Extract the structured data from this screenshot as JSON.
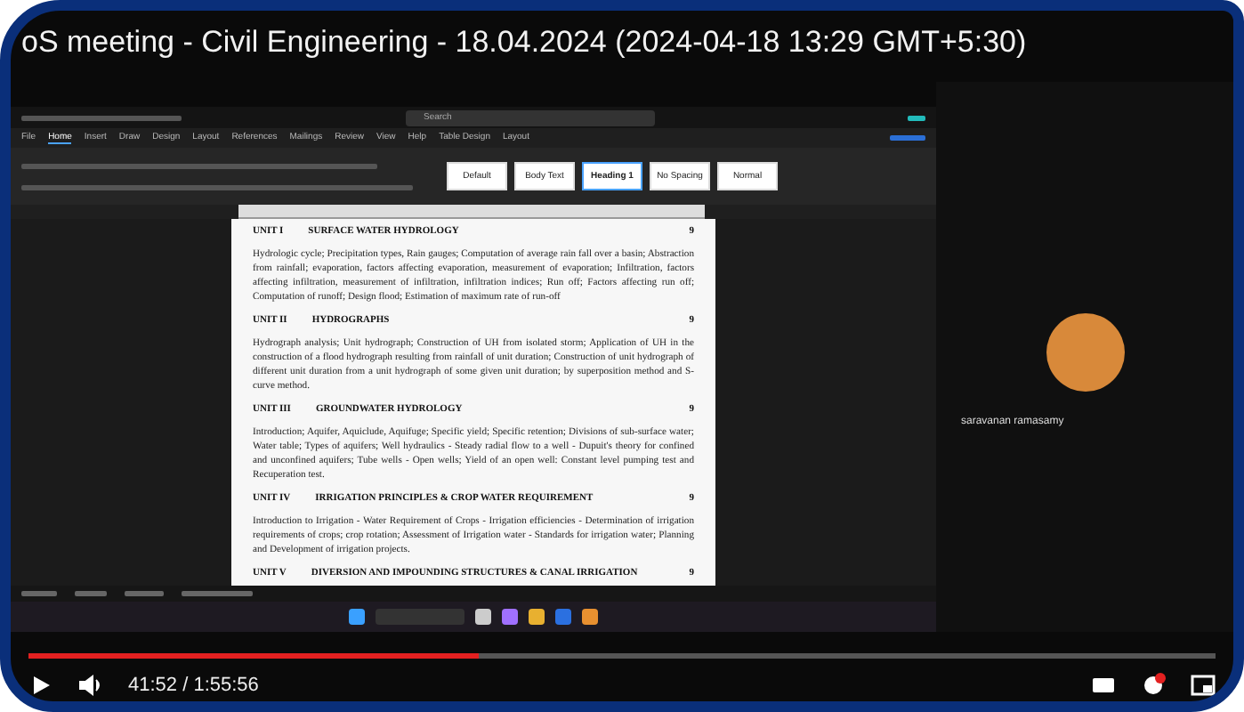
{
  "video": {
    "title": "oS meeting - Civil Engineering - 18.04.2024 (2024-04-18 13:29 GMT+5:30)"
  },
  "word": {
    "search": {
      "placeholder": "Search"
    },
    "menu_tabs": [
      {
        "label": "File",
        "selected": false
      },
      {
        "label": "Home",
        "selected": true
      },
      {
        "label": "Insert",
        "selected": false
      },
      {
        "label": "Draw",
        "selected": false
      },
      {
        "label": "Design",
        "selected": false
      },
      {
        "label": "Layout",
        "selected": false
      },
      {
        "label": "References",
        "selected": false
      },
      {
        "label": "Mailings",
        "selected": false
      },
      {
        "label": "Review",
        "selected": false
      },
      {
        "label": "View",
        "selected": false
      },
      {
        "label": "Help",
        "selected": false
      },
      {
        "label": "Table Design",
        "selected": false
      },
      {
        "label": "Layout",
        "selected": false
      }
    ],
    "styles": [
      {
        "label": "Default",
        "selected": false
      },
      {
        "label": "Body Text",
        "selected": false
      },
      {
        "label": "Heading 1",
        "selected": true
      },
      {
        "label": "No Spacing",
        "selected": false
      },
      {
        "label": "Normal",
        "selected": false
      }
    ],
    "document": [
      {
        "heading": "UNIT I",
        "title": "SURFACE WATER HYDROLOGY",
        "hours": "9",
        "body": "Hydrologic cycle; Precipitation types, Rain gauges; Computation of average rain fall over a basin; Abstraction from rainfall; evaporation, factors affecting evaporation, measurement of evaporation; Infiltration, factors affecting infiltration, measurement of infiltration, infiltration indices; Run off; Factors affecting run off; Computation of runoff; Design flood; Estimation of maximum rate of run-off"
      },
      {
        "heading": "UNIT II",
        "title": "HYDROGRAPHS",
        "hours": "9",
        "body": "Hydrograph analysis; Unit hydrograph; Construction of UH from isolated storm; Application of UH in the construction of a flood hydrograph resulting from rainfall of unit duration; Construction of unit hydrograph of different unit duration from a unit hydrograph of some given unit duration; by superposition method and S-curve method."
      },
      {
        "heading": "UNIT III",
        "title": "GROUNDWATER HYDROLOGY",
        "hours": "9",
        "body": "Introduction; Aquifer, Aquiclude, Aquifuge; Specific yield; Specific retention; Divisions of sub-surface water; Water table; Types of aquifers; Well hydraulics - Steady radial flow to a well - Dupuit's theory for confined and unconfined aquifers; Tube wells - Open wells; Yield of an open well: Constant level pumping test and Recuperation test."
      },
      {
        "heading": "UNIT IV",
        "title": "IRRIGATION PRINCIPLES & CROP WATER REQUIREMENT",
        "hours": "9",
        "body": "Introduction to Irrigation - Water Requirement of Crops - Irrigation efficiencies - Determination of irrigation requirements of crops; crop rotation; Assessment of Irrigation water - Standards for irrigation water; Planning and Development of irrigation projects."
      },
      {
        "heading": "UNIT V",
        "title": "DIVERSION AND IMPOUNDING STRUCTURES & CANAL IRRIGATION",
        "hours": "9"
      }
    ]
  },
  "participant": {
    "name": "saravanan ramasamy"
  },
  "player": {
    "progress": {
      "level": 0.38
    },
    "time": "41:52 / 1:55:56"
  }
}
